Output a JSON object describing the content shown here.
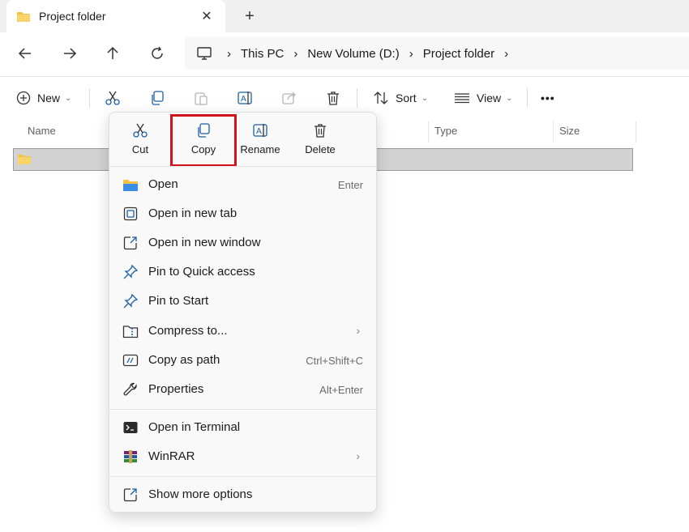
{
  "tab": {
    "title": "Project folder",
    "close": "✕",
    "new_tab": "+"
  },
  "address": {
    "crumbs": [
      "This PC",
      "New Volume (D:)",
      "Project folder"
    ],
    "separator": "›"
  },
  "command_bar": {
    "new_label": "New",
    "sort_label": "Sort",
    "view_label": "View",
    "more": "•••",
    "caret": "⌄"
  },
  "columns": {
    "name": "Name",
    "type": "Type",
    "size": "Size"
  },
  "context_menu": {
    "quick_actions": [
      {
        "label": "Cut"
      },
      {
        "label": "Copy"
      },
      {
        "label": "Rename"
      },
      {
        "label": "Delete"
      }
    ],
    "items": [
      {
        "label": "Open",
        "shortcut": "Enter"
      },
      {
        "label": "Open in new tab",
        "shortcut": ""
      },
      {
        "label": "Open in new window",
        "shortcut": ""
      },
      {
        "label": "Pin to Quick access",
        "shortcut": ""
      },
      {
        "label": "Pin to Start",
        "shortcut": ""
      },
      {
        "label": "Compress to...",
        "shortcut": ""
      },
      {
        "label": "Copy as path",
        "shortcut": "Ctrl+Shift+C"
      },
      {
        "label": "Properties",
        "shortcut": "Alt+Enter"
      },
      {
        "label": "Open in Terminal",
        "shortcut": ""
      },
      {
        "label": "WinRAR",
        "shortcut": ""
      },
      {
        "label": "Show more options",
        "shortcut": ""
      }
    ],
    "submenu_arrow": "›"
  },
  "colors": {
    "accent": "#0067c0",
    "highlight_border": "#d0141c",
    "folder": "#f6c244"
  }
}
